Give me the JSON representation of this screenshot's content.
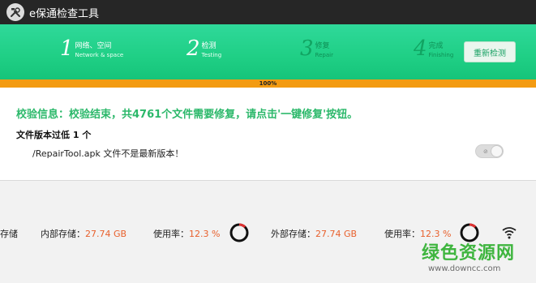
{
  "titlebar": {
    "title": "e保通检查工具",
    "icon": "tools-icon"
  },
  "steps": [
    {
      "num": "1",
      "title": "网络、空间",
      "sub": "Network & space",
      "active": true
    },
    {
      "num": "2",
      "title": "检测",
      "sub": "Testing",
      "active": true
    },
    {
      "num": "3",
      "title": "修复",
      "sub": "Repair",
      "active": false
    },
    {
      "num": "4",
      "title": "完成",
      "sub": "Finishing",
      "active": false
    }
  ],
  "recheck_label": "重新检测",
  "progress": {
    "percent": 100,
    "label": "100%",
    "fill_color": "#f39b12",
    "track_color": "#2a8ef0"
  },
  "info": {
    "message": "校验信息：校验结束，共4761个文件需要修复，请点击'一键修复'按钮。",
    "version_heading": "文件版本过低 1 个",
    "file_line": "/RepairTool.apk 文件不是最新版本！"
  },
  "storage": {
    "partial_label": "存储",
    "internal_label": "内部存储：",
    "internal_value": "27.74 GB",
    "usage_label_1": "使用率：",
    "usage_value_1": "12.3 %",
    "usage_fraction_1": 0.123,
    "external_label": "外部存储：",
    "external_value": "27.74 GB",
    "usage_label_2": "使用率：",
    "usage_value_2": "12.3 %",
    "usage_fraction_2": 0.123
  },
  "watermark": {
    "title": "绿色资源网",
    "url": "www.downcc.com"
  },
  "colors": {
    "accent_green": "#1fcf85",
    "info_green": "#2bb86a",
    "value_orange": "#e8602c",
    "ring_red": "#e03030"
  }
}
